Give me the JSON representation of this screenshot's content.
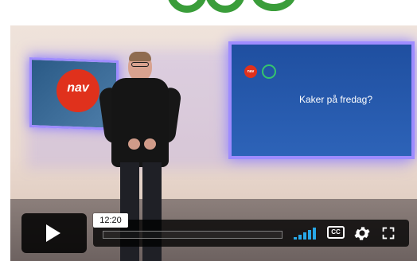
{
  "player": {
    "slide_title": "Kaker på fredag?",
    "time_label": "12:20",
    "left_logo_text": "nav",
    "progress_fraction": 0,
    "icons": {
      "play": "play-icon",
      "volume": "volume-icon",
      "captions": "cc-icon",
      "settings": "gear-icon",
      "fullscreen": "fullscreen-icon"
    },
    "cc_label": "CC"
  },
  "colors": {
    "accent_green": "#3a9d3a",
    "nav_red": "#e0311c",
    "progress_blue": "#00adef",
    "slide_blue": "#2d63b8"
  }
}
